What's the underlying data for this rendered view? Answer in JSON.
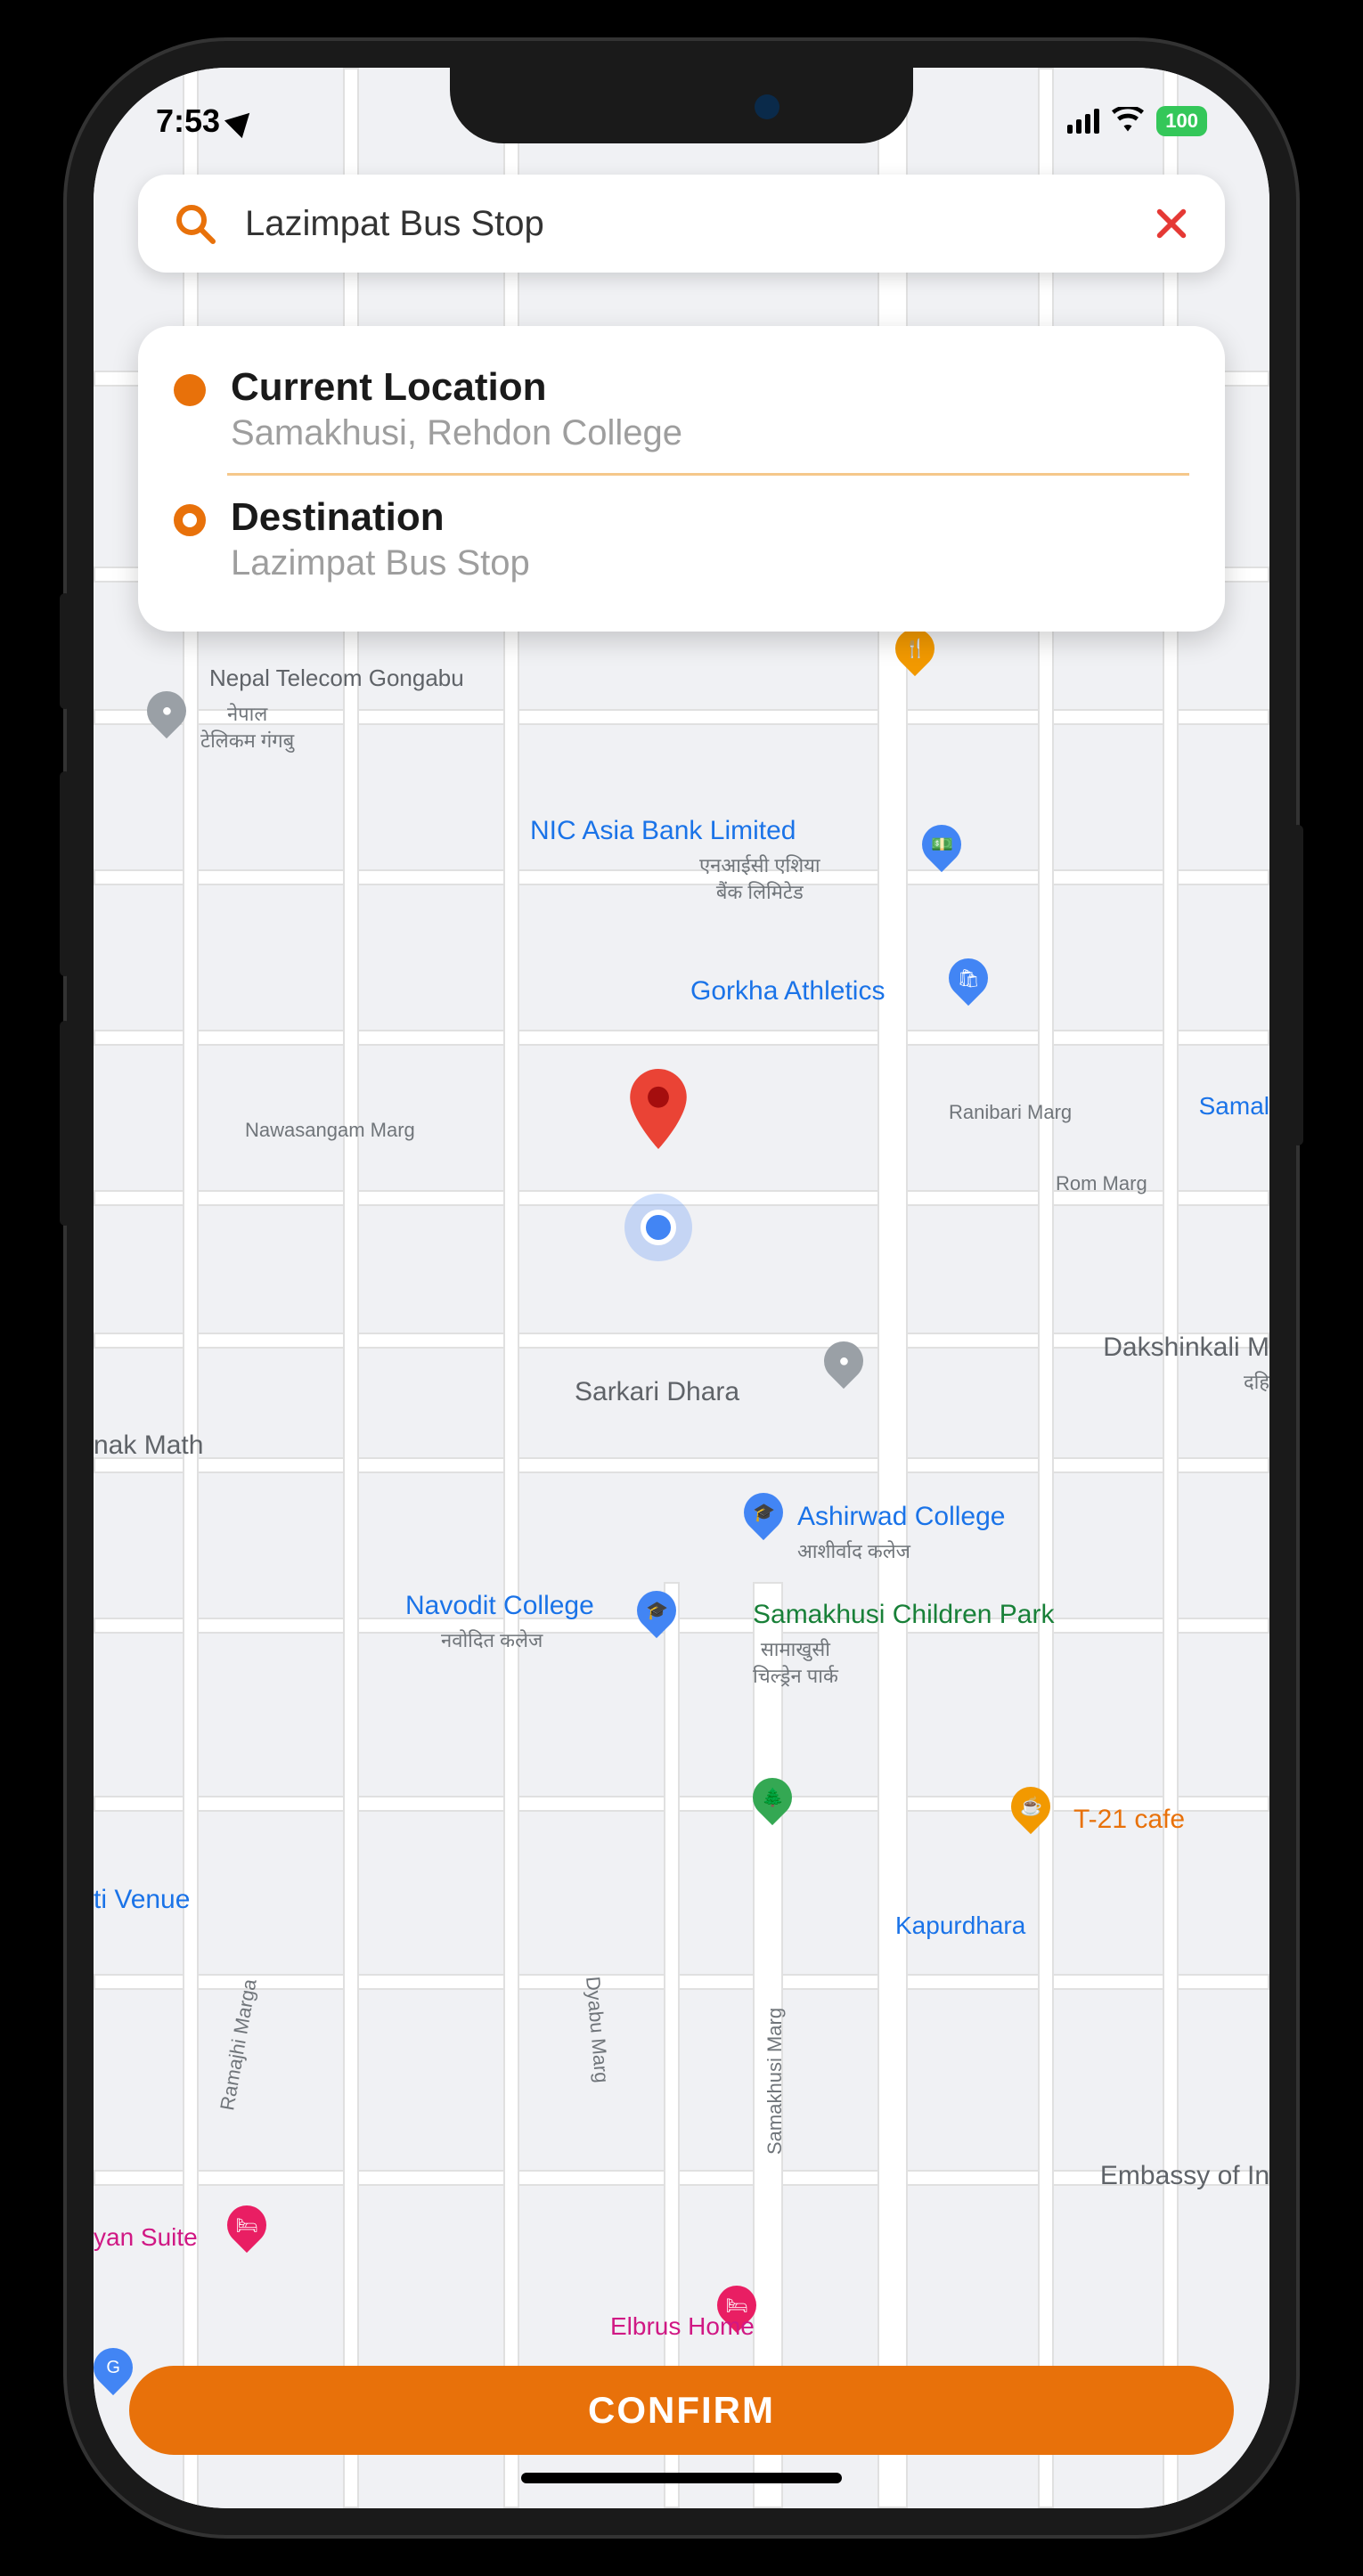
{
  "status": {
    "time": "7:53",
    "battery": "100"
  },
  "search": {
    "value": "Lazimpat Bus Stop"
  },
  "locations": {
    "current": {
      "title": "Current Location",
      "subtitle": "Samakhusi, Rehdon College"
    },
    "destination": {
      "title": "Destination",
      "subtitle": "Lazimpat Bus Stop"
    }
  },
  "confirm_label": "CONFIRM",
  "map_labels": {
    "nepal_telecom": "Nepal Telecom Gongabu",
    "nepal_telecom_np": "नेपाल\nटेलिकम गंगबु",
    "nic_asia": "NIC Asia Bank Limited",
    "nic_asia_np": "एनआईसी एशिया\nबैंक लिमिटेड",
    "gorkha": "Gorkha Athletics",
    "nawasangam": "Nawasangam Marg",
    "ranibari": "Ranibari Marg",
    "samal": "Samal",
    "rom": "Rom Marg",
    "dakshinkali": "Dakshinkali M",
    "dakshinkali_np": "दहि",
    "sarkari": "Sarkari Dhara",
    "nak_math": "nak Math",
    "ashirwad": "Ashirwad College",
    "ashirwad_np": "आशीर्वाद कलेज",
    "navodit": "Navodit College",
    "navodit_np": "नवोदित कलेज",
    "children_park": "Samakhusi Children Park",
    "children_park_np": "सामाखुसी\nचिल्ड्रेन पार्क",
    "t21": "T-21 cafe",
    "ti_venue": "ti Venue",
    "kapurdhara": "Kapurdhara",
    "embassy": "Embassy of In",
    "dyabu": "Dyabu Marg",
    "samakhusi_marg": "Samakhusi Marg",
    "ramajhi": "Ramajhi Marga",
    "yan_suite": "yan Suite",
    "elbrus": "Elbrus Home",
    "g_label": "G"
  }
}
